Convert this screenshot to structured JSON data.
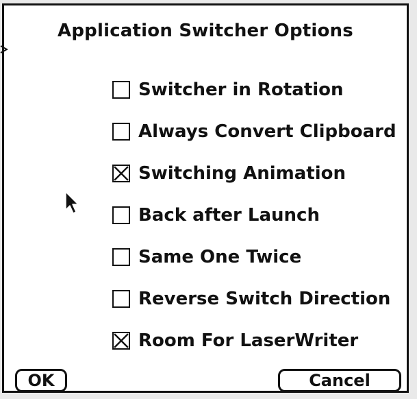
{
  "dialog": {
    "title": "Application Switcher Options",
    "options": [
      {
        "label": "Switcher in Rotation",
        "checked": false
      },
      {
        "label": "Always Convert Clipboard",
        "checked": false
      },
      {
        "label": "Switching Animation",
        "checked": true
      },
      {
        "label": "Back after Launch",
        "checked": false
      },
      {
        "label": "Same One Twice",
        "checked": false
      },
      {
        "label": "Reverse Switch Direction",
        "checked": false
      },
      {
        "label": "Room For LaserWriter",
        "checked": true
      }
    ],
    "buttons": {
      "ok_label": "OK",
      "cancel_label": "Cancel"
    }
  },
  "icons": {
    "cursor": "arrow-cursor-icon",
    "checkmark": "x-check-icon"
  },
  "colors": {
    "ink": "#111111",
    "background": "#ffffff"
  }
}
